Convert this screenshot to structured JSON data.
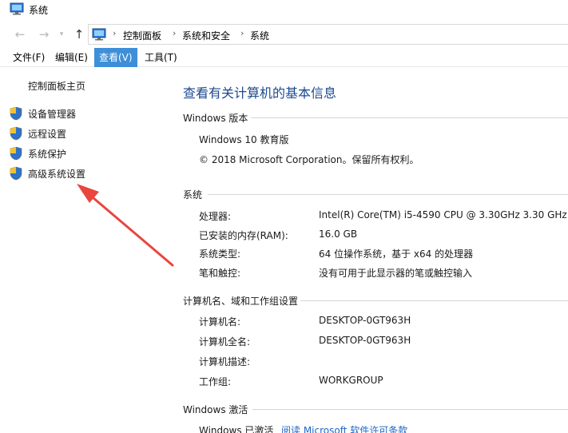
{
  "window": {
    "title": "系统"
  },
  "address": {
    "crumbs": [
      "控制面板",
      "系统和安全",
      "系统"
    ]
  },
  "menu": {
    "file": "文件(F)",
    "edit": "编辑(E)",
    "view": "查看(V)",
    "tools": "工具(T)"
  },
  "sidebar": {
    "home": "控制面板主页",
    "items": [
      {
        "label": "设备管理器",
        "icon": "uac-shield-icon"
      },
      {
        "label": "远程设置",
        "icon": "uac-shield-icon"
      },
      {
        "label": "系统保护",
        "icon": "uac-shield-icon"
      },
      {
        "label": "高级系统设置",
        "icon": "uac-shield-icon"
      }
    ]
  },
  "annotation": {
    "arrow_color": "#e8463f"
  },
  "main": {
    "title": "查看有关计算机的基本信息",
    "edition": {
      "header": "Windows 版本",
      "name": "Windows 10 教育版",
      "copyright": "© 2018 Microsoft Corporation。保留所有权利。"
    },
    "system": {
      "header": "系统",
      "rows": [
        {
          "label": "处理器:",
          "value": "Intel(R) Core(TM) i5-4590 CPU @ 3.30GHz   3.30 GHz"
        },
        {
          "label": "已安装的内存(RAM):",
          "value": "16.0 GB"
        },
        {
          "label": "系统类型:",
          "value": "64 位操作系统，基于 x64 的处理器"
        },
        {
          "label": "笔和触控:",
          "value": "没有可用于此显示器的笔或触控输入"
        }
      ]
    },
    "computer": {
      "header": "计算机名、域和工作组设置",
      "rows": [
        {
          "label": "计算机名:",
          "value": "DESKTOP-0GT963H"
        },
        {
          "label": "计算机全名:",
          "value": "DESKTOP-0GT963H"
        },
        {
          "label": "计算机描述:",
          "value": ""
        },
        {
          "label": "工作组:",
          "value": "WORKGROUP"
        }
      ]
    },
    "activation": {
      "header": "Windows 激活",
      "status": "Windows 已激活",
      "link": "阅读 Microsoft 软件许可条款"
    }
  },
  "colors": {
    "menu_active": "#3c8fd8",
    "title_blue": "#1c4a8f",
    "link_blue": "#1e66c8"
  }
}
